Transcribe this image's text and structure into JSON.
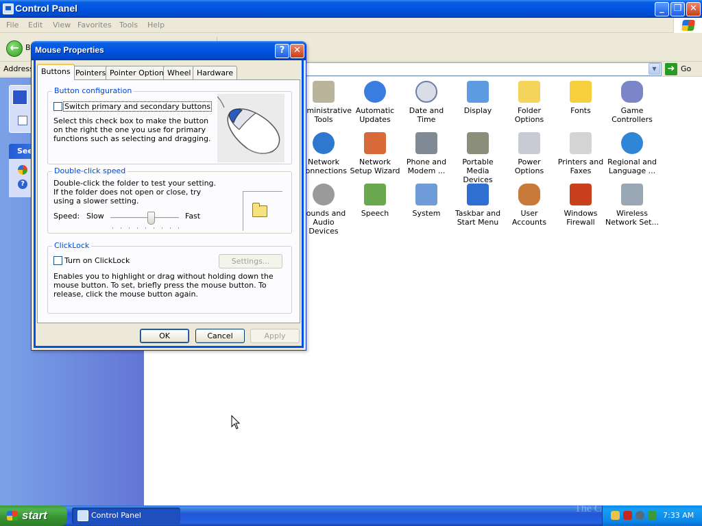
{
  "window": {
    "title": "Control Panel",
    "controls": {
      "minimize": "_",
      "restore": "❐",
      "close": "✕"
    }
  },
  "menu": [
    "File",
    "Edit",
    "View",
    "Favorites",
    "Tools",
    "Help"
  ],
  "toolbar": {
    "back_label": "B"
  },
  "address": {
    "label": "Address",
    "go_label": "Go"
  },
  "left_pane": {
    "see_also_header": "See"
  },
  "control_panel_items": [
    {
      "label": "Administrative Tools",
      "color": "#b9b49a",
      "icon": "admin-tools-icon"
    },
    {
      "label": "Automatic Updates",
      "color": "#3a7de0",
      "icon": "windows-update-icon"
    },
    {
      "label": "Date and Time",
      "color": "#d9dde8",
      "icon": "clock-icon"
    },
    {
      "label": "Display",
      "color": "#5f9be0",
      "icon": "display-icon"
    },
    {
      "label": "Folder Options",
      "color": "#f4d35a",
      "icon": "folder-options-icon"
    },
    {
      "label": "Fonts",
      "color": "#f6cf3c",
      "icon": "fonts-folder-icon"
    },
    {
      "label": "Game Controllers",
      "color": "#7b86c8",
      "icon": "gamepad-icon"
    },
    {
      "label": "Network Connections",
      "color": "#2f78d0",
      "icon": "network-globe-icon"
    },
    {
      "label": "Network Setup Wizard",
      "color": "#d86a3a",
      "icon": "home-network-icon"
    },
    {
      "label": "Phone and Modem ...",
      "color": "#7f8a94",
      "icon": "phone-icon"
    },
    {
      "label": "Portable Media Devices",
      "color": "#8a8e7a",
      "icon": "media-device-icon"
    },
    {
      "label": "Power Options",
      "color": "#c8cbd4",
      "icon": "power-icon"
    },
    {
      "label": "Printers and Faxes",
      "color": "#d4d4d4",
      "icon": "printer-icon"
    },
    {
      "label": "Regional and Language ...",
      "color": "#2f86d6",
      "icon": "globe-icon"
    },
    {
      "label": "Sounds and Audio Devices",
      "color": "#9a9a9a",
      "icon": "speaker-icon"
    },
    {
      "label": "Speech",
      "color": "#6aa84f",
      "icon": "speech-icon"
    },
    {
      "label": "System",
      "color": "#6f9bd9",
      "icon": "system-icon"
    },
    {
      "label": "Taskbar and Start Menu",
      "color": "#2f6fd1",
      "icon": "taskbar-icon"
    },
    {
      "label": "User Accounts",
      "color": "#c87a3a",
      "icon": "users-icon"
    },
    {
      "label": "Windows Firewall",
      "color": "#c8401c",
      "icon": "firewall-icon"
    },
    {
      "label": "Wireless Network Set...",
      "color": "#9aa7b4",
      "icon": "wireless-icon"
    }
  ],
  "dialog": {
    "title": "Mouse Properties",
    "help_label": "?",
    "close_label": "✕",
    "tabs": [
      "Buttons",
      "Pointers",
      "Pointer Options",
      "Wheel",
      "Hardware"
    ],
    "button_config": {
      "legend": "Button configuration",
      "checkbox_label": "Switch primary and secondary buttons",
      "checked": false,
      "description": "Select this check box to make the button on the right the one you use for primary functions such as selecting and dragging."
    },
    "double_click": {
      "legend": "Double-click speed",
      "description": "Double-click the folder to test your setting. If the folder does not open or close, try using a slower setting.",
      "speed_label": "Speed:",
      "slow_label": "Slow",
      "fast_label": "Fast"
    },
    "clicklock": {
      "legend": "ClickLock",
      "checkbox_label": "Turn on ClickLock",
      "checked": false,
      "settings_label": "Settings...",
      "description": "Enables you to highlight or drag without holding down the mouse button. To set, briefly press the mouse button. To release, click the mouse button again."
    },
    "buttons": {
      "ok": "OK",
      "cancel": "Cancel",
      "apply": "Apply"
    }
  },
  "taskbar": {
    "start_label": "start",
    "task_label": "Control Panel",
    "clock": "7:33 AM",
    "watermark": "The C"
  }
}
